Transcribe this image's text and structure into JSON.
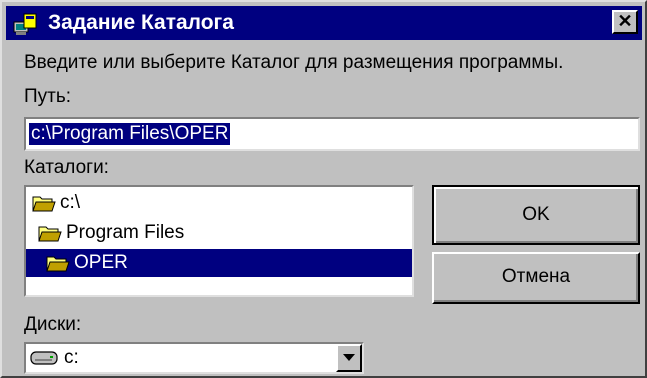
{
  "window": {
    "title": "Задание Каталога",
    "close_label": "✕"
  },
  "prompt": "Введите или выберите Каталог для размещения программы.",
  "path": {
    "label": "Путь:",
    "value": "c:\\Program Files\\OPER"
  },
  "folders": {
    "label": "Каталоги:",
    "items": [
      {
        "label": "c:\\",
        "icon": "open-folder-icon",
        "selected": false
      },
      {
        "label": "Program Files",
        "icon": "open-folder-icon",
        "selected": false
      },
      {
        "label": "OPER",
        "icon": "open-folder-icon",
        "selected": true
      }
    ]
  },
  "buttons": {
    "ok": "OK",
    "cancel": "Отмена"
  },
  "drives": {
    "label": "Диски:",
    "selected": "c:",
    "icon": "drive-icon"
  },
  "colors": {
    "titlebar": "#000080",
    "face": "#c0c0c0",
    "selection": "#000080"
  }
}
